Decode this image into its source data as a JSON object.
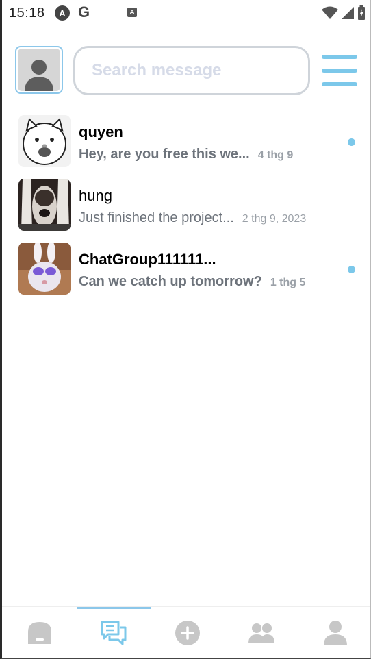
{
  "status_bar": {
    "time": "15:18",
    "letter_a": "A",
    "letter_g": "G",
    "letter_a_small": "A"
  },
  "header": {
    "search_placeholder": "Search message"
  },
  "conversations": [
    {
      "name": "quyen",
      "message": "Hey, are you free this we...",
      "date": "4 thg 9",
      "unread": true
    },
    {
      "name": "hung",
      "message": "Just finished the project...",
      "date": "2 thg 9, 2023",
      "unread": false
    },
    {
      "name": "ChatGroup111111...",
      "message": "Can we catch up tomorrow?",
      "date": "1 thg 5",
      "unread": true
    }
  ],
  "nav": {
    "active_tab": "messages",
    "tabs": [
      "home",
      "messages",
      "add",
      "friends",
      "profile"
    ]
  },
  "colors": {
    "accent": "#7cc8ea",
    "icon_gray": "#c7c7c7"
  }
}
